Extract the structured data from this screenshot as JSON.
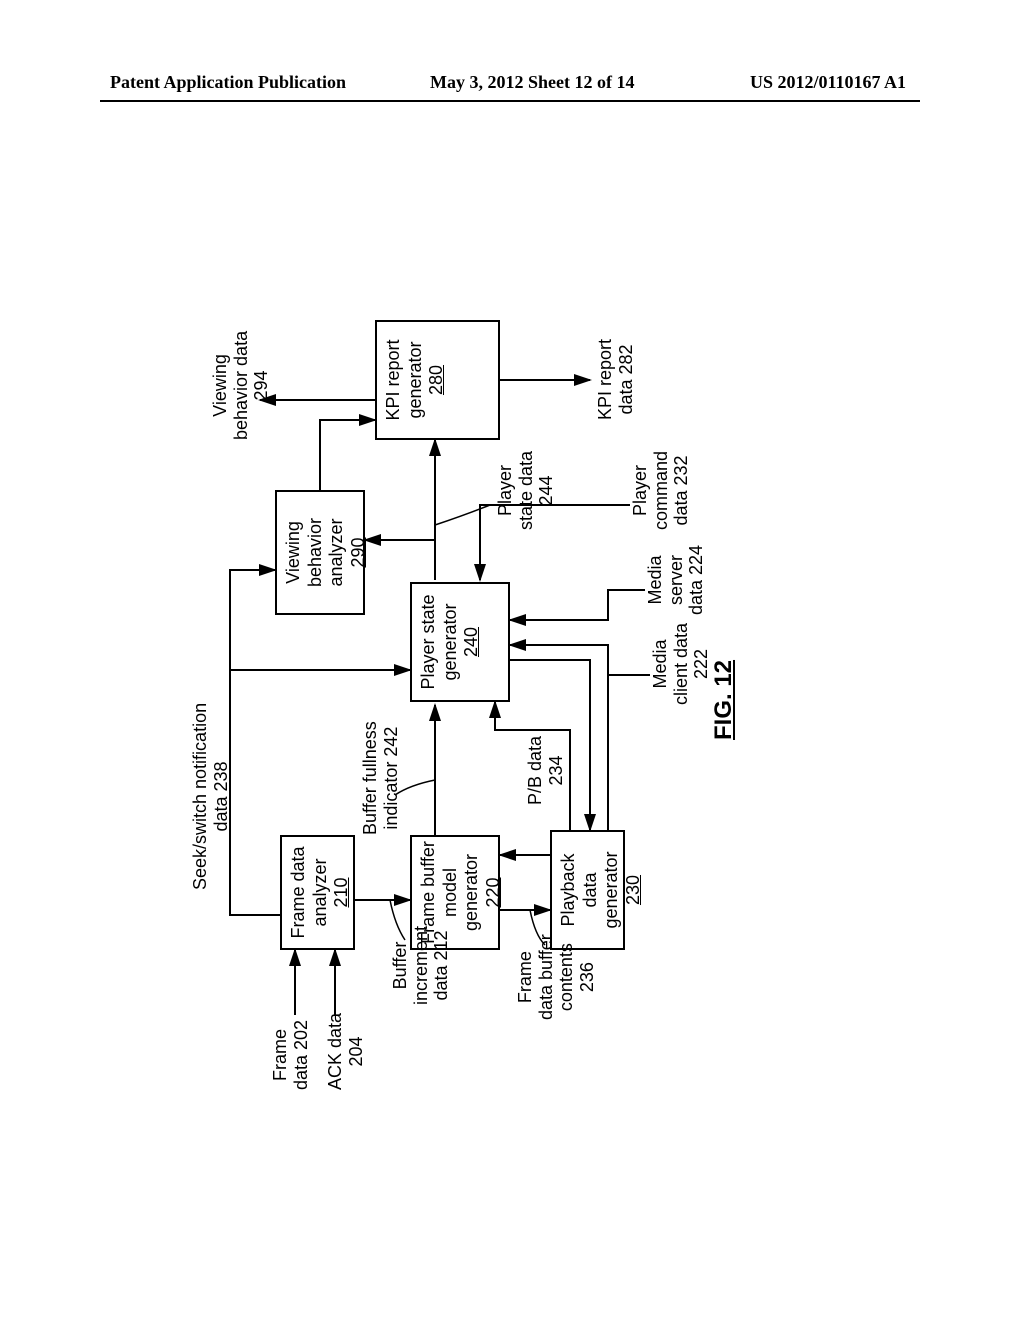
{
  "header": {
    "left": "Patent Application Publication",
    "center": "May 3, 2012  Sheet 12 of 14",
    "right": "US 2012/0110167 A1"
  },
  "boxes": {
    "frame_data_analyzer": {
      "title": "Frame data\nanalyzer",
      "num": "210"
    },
    "frame_buffer_model_generator": {
      "title": "Frame buffer\nmodel\ngenerator",
      "num": "220"
    },
    "playback_data_generator": {
      "title": "Playback data\ngenerator",
      "num": "230"
    },
    "player_state_generator": {
      "title": "Player state\ngenerator",
      "num": "240"
    },
    "kpi_report_generator": {
      "title": "KPI report\ngenerator",
      "num": "280"
    },
    "viewing_behavior_analyzer": {
      "title": "Viewing\nbehavior\nanalyzer",
      "num": "290"
    }
  },
  "labels": {
    "frame_data": {
      "text": "Frame\ndata 202"
    },
    "ack_data": {
      "text": "ACK data\n204"
    },
    "seek_switch": {
      "text": "Seek/switch notification\ndata 238"
    },
    "buffer_increment": {
      "text": "Buffer\nincrement\ndata 212"
    },
    "buffer_fullness": {
      "text": "Buffer fullness\nindicator 242"
    },
    "frame_data_buffer_contents": {
      "text": "Frame\ndata buffer\ncontents\n236"
    },
    "pb_data": {
      "text": "P/B data\n234"
    },
    "media_client_data": {
      "text": "Media\nclient data\n222"
    },
    "media_server_data": {
      "text": "Media\nserver\ndata 224"
    },
    "player_command_data": {
      "text": "Player\ncommand\ndata 232"
    },
    "player_state_data": {
      "text": "Player\nstate data\n244"
    },
    "viewing_behavior_data": {
      "text": "Viewing\nbehavior data\n294"
    },
    "kpi_report_data": {
      "text": "KPI report\ndata 282"
    }
  },
  "figure_caption": "FIG. 12"
}
